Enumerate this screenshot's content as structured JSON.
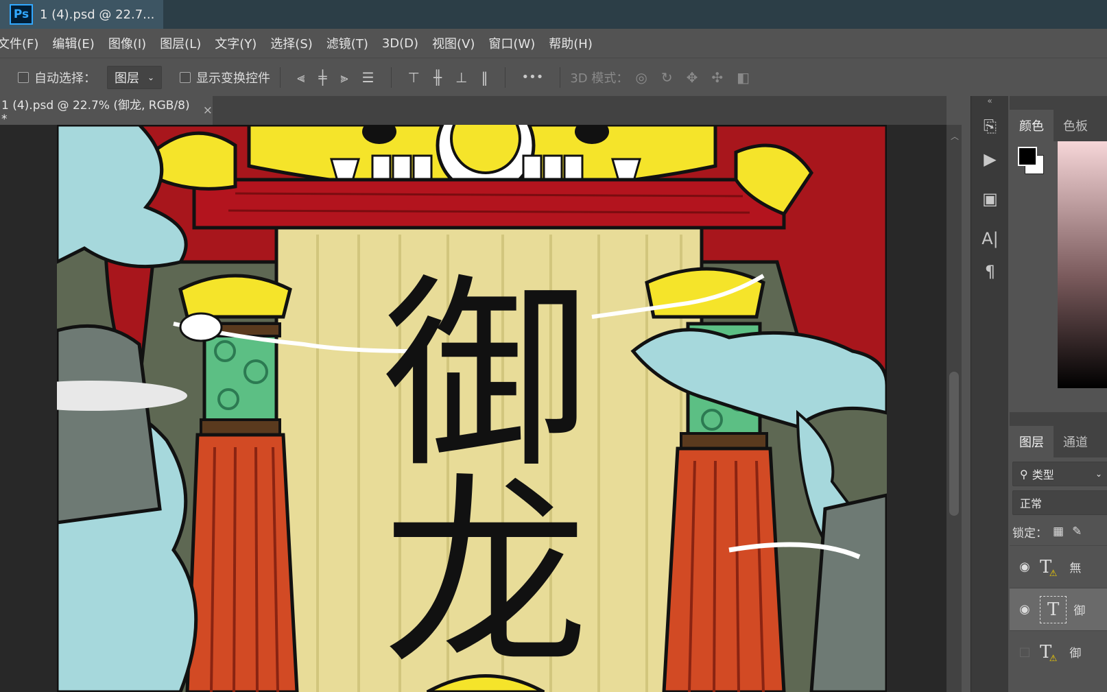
{
  "window": {
    "app_badge": "Ps",
    "title": "1 (4).psd @ 22.7..."
  },
  "menu": [
    {
      "label": "文件(F)",
      "name": "menu-file"
    },
    {
      "label": "编辑(E)",
      "name": "menu-edit"
    },
    {
      "label": "图像(I)",
      "name": "menu-image"
    },
    {
      "label": "图层(L)",
      "name": "menu-layer"
    },
    {
      "label": "文字(Y)",
      "name": "menu-type"
    },
    {
      "label": "选择(S)",
      "name": "menu-select"
    },
    {
      "label": "滤镜(T)",
      "name": "menu-filter"
    },
    {
      "label": "3D(D)",
      "name": "menu-3d"
    },
    {
      "label": "视图(V)",
      "name": "menu-view"
    },
    {
      "label": "窗口(W)",
      "name": "menu-window"
    },
    {
      "label": "帮助(H)",
      "name": "menu-help"
    }
  ],
  "options": {
    "auto_select_label": "自动选择：",
    "auto_select_value": "图层",
    "show_transform_label": "显示变换控件",
    "more": "•••",
    "mode_3d_label": "3D 模式："
  },
  "document": {
    "tab_label": "1 (4).psd @ 22.7% (御龙, RGB/8) *",
    "close": "×"
  },
  "artwork": {
    "title_char_1": "御",
    "title_char_2": "龙"
  },
  "panels": {
    "color_tab": "颜色",
    "swatches_tab": "色板",
    "layers_tab": "图层",
    "channels_tab": "通道",
    "filter_kind": "类型",
    "blend_mode": "正常",
    "lock_label": "锁定："
  },
  "layers": [
    {
      "name": "無",
      "visible": true
    },
    {
      "name": "御",
      "visible": true
    },
    {
      "name": "御",
      "visible": false
    }
  ],
  "colors": {
    "foreground": "#000000",
    "background": "#ffffff",
    "ps_blue": "#31a8ff",
    "scroll_bg": "#e8dc98",
    "lacquer_red": "#b3141e",
    "tassel_red": "#d24a24",
    "dragon_yellow": "#f5e42a",
    "cloud_cyan": "#a6d8dc"
  }
}
